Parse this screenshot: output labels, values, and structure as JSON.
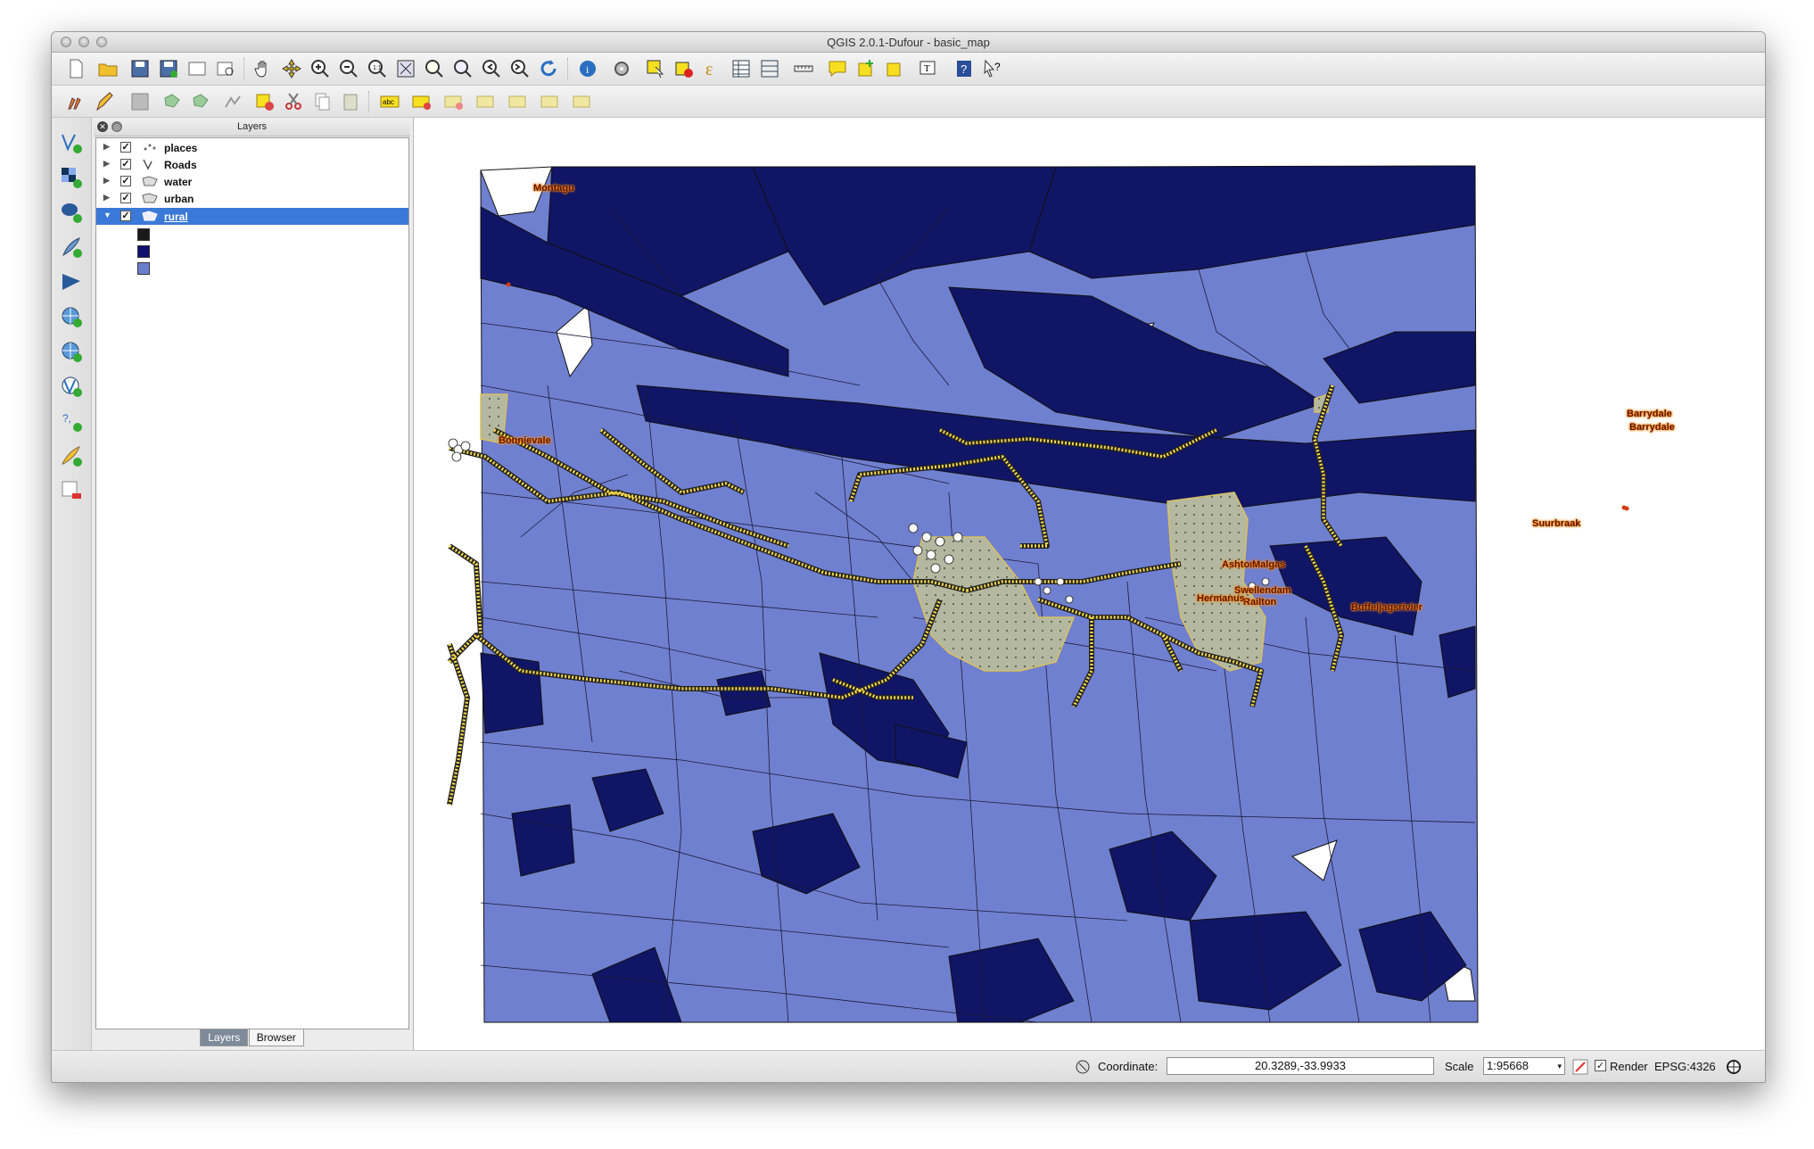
{
  "window": {
    "title": "QGIS 2.0.1-Dufour - basic_map"
  },
  "toolbar1": {
    "buttons": [
      "new-project",
      "open-project",
      "save-project",
      "save-as",
      "new-print-composer",
      "composer-manager",
      "pan",
      "pan-to-selection",
      "zoom-in",
      "zoom-out",
      "zoom-actual",
      "zoom-full",
      "zoom-to-selection",
      "zoom-to-layer",
      "zoom-last",
      "zoom-next",
      "refresh",
      "identify",
      "action",
      "select",
      "deselect",
      "field-calculator",
      "attribute-table",
      "statistics",
      "measure",
      "map-tips",
      "new-bookmark",
      "show-bookmarks",
      "text-annotation",
      "help",
      "whats-this"
    ]
  },
  "toolbar2": {
    "buttons": [
      "current-edits",
      "toggle-editing",
      "save-edits",
      "add-feature",
      "move-feature",
      "node-tool",
      "delete-selected",
      "cut-features",
      "copy-features",
      "paste-features",
      "label-abc",
      "pin-labels",
      "show-hide-labels",
      "move-label",
      "rotate-label",
      "change-label",
      "label-settings"
    ]
  },
  "left_toolbar": [
    "add-vector-layer",
    "add-raster-layer",
    "add-postgis-layer",
    "add-spatialite-layer",
    "add-mssql-layer",
    "add-wms-layer",
    "add-wcs-layer",
    "add-wfs-layer",
    "add-delimited-text-layer",
    "new-shapefile-layer",
    "remove-layer"
  ],
  "layers_panel": {
    "title": "Layers",
    "layers": [
      {
        "name": "places",
        "checked": true,
        "icon": "point-layer-icon",
        "selected": false
      },
      {
        "name": "Roads",
        "checked": true,
        "icon": "line-layer-icon",
        "selected": false
      },
      {
        "name": "water",
        "checked": true,
        "icon": "polygon-layer-icon",
        "selected": false
      },
      {
        "name": "urban",
        "checked": true,
        "icon": "polygon-layer-icon",
        "selected": false
      },
      {
        "name": "rural",
        "checked": true,
        "icon": "polygon-layer-icon",
        "selected": true
      }
    ],
    "legend_colors": [
      "#1a1a1a",
      "#101070",
      "#6b7fcf"
    ],
    "tabs": [
      "Layers",
      "Browser"
    ]
  },
  "map": {
    "colors": {
      "rural_light": "#7080d0",
      "rural_dark": "#101565",
      "urban": "#b4b8a0",
      "road": "#f0d040",
      "background": "#ffffff"
    },
    "labels": [
      "Montagu",
      "Barrydale",
      "Barrydale",
      "Bonnievale",
      "Suurbraak",
      "Buffeljagsrivier",
      "Swellendam",
      "Railton",
      "Hermanus",
      "Ashton",
      "Malgas"
    ]
  },
  "status": {
    "coordinate_label": "Coordinate:",
    "coordinate_value": "20.3289,-33.9933",
    "scale_label": "Scale",
    "scale_value": "1:95668",
    "render_label": "Render",
    "render_checked": true,
    "crs": "EPSG:4326"
  }
}
